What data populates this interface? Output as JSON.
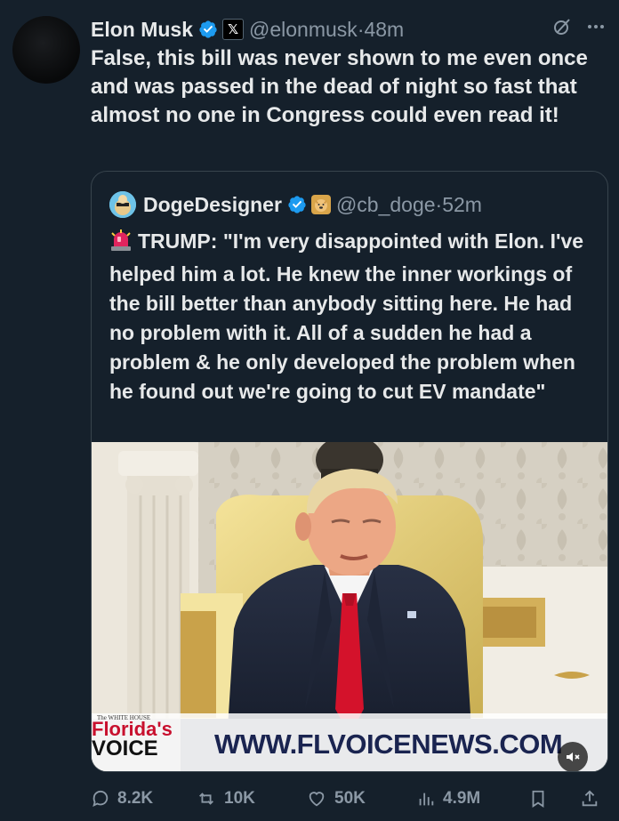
{
  "tweet": {
    "author_name": "Elon Musk",
    "x_badge": "𝕏",
    "handle": "@elonmusk",
    "time": "·48m",
    "text": "False, this bill was never shown to me even once and was passed in the dead of night so fast that almost no one in Congress could even read it!"
  },
  "quote": {
    "author_name": "DogeDesigner",
    "handle": "@cb_doge",
    "time": "·52m",
    "text": "TRUMP: \"I'm very disappointed with Elon. I've helped him a lot. He knew the inner workings of the bill better than anybody sitting here. He had no problem with it. All of a sudden he had a problem & he only developed the problem when he found out we're going to cut EV mandate\"",
    "media": {
      "lower_third_small": "The WHITE HOUSE",
      "brand_line1": "Florida's",
      "brand_line2": "VOICE",
      "url_banner": "WWW.FLVOICENEWS.COM",
      "mute_label": "x"
    }
  },
  "actions": {
    "replies": "8.2K",
    "reposts": "10K",
    "likes": "50K",
    "views": "4.9M"
  },
  "colors": {
    "background": "#15202b",
    "text": "#e7e9ea",
    "muted": "#8b98a5",
    "verified": "#1d9bf0",
    "border": "#38444d"
  }
}
